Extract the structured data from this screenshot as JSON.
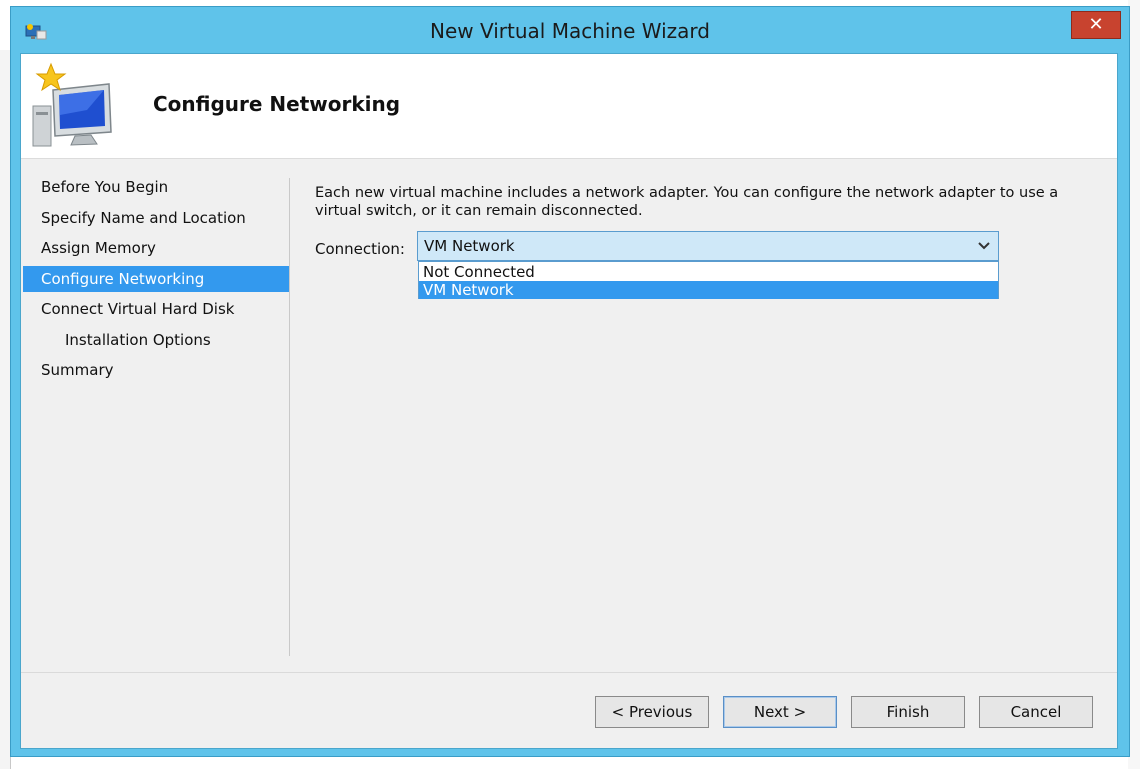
{
  "window": {
    "title": "New Virtual Machine Wizard",
    "close_glyph": "✕"
  },
  "header": {
    "title": "Configure Networking"
  },
  "nav": {
    "items": [
      {
        "label": "Before You Begin"
      },
      {
        "label": "Specify Name and Location"
      },
      {
        "label": "Assign Memory"
      },
      {
        "label": "Configure Networking",
        "active": true
      },
      {
        "label": "Connect Virtual Hard Disk"
      },
      {
        "label": "Installation Options",
        "sub": true
      },
      {
        "label": "Summary"
      }
    ]
  },
  "content": {
    "description": "Each new virtual machine includes a network adapter. You can configure the network adapter to use a virtual switch, or it can remain disconnected.",
    "connection_label": "Connection:",
    "connection_value": "VM Network",
    "options": [
      "Not Connected",
      "VM Network"
    ],
    "selected_option": "VM Network"
  },
  "buttons": {
    "previous": "< Previous",
    "next": "Next >",
    "finish": "Finish",
    "cancel": "Cancel"
  },
  "colors": {
    "titlebar": "#5fc3ea",
    "selection": "#3399ee",
    "close": "#c8432f"
  }
}
